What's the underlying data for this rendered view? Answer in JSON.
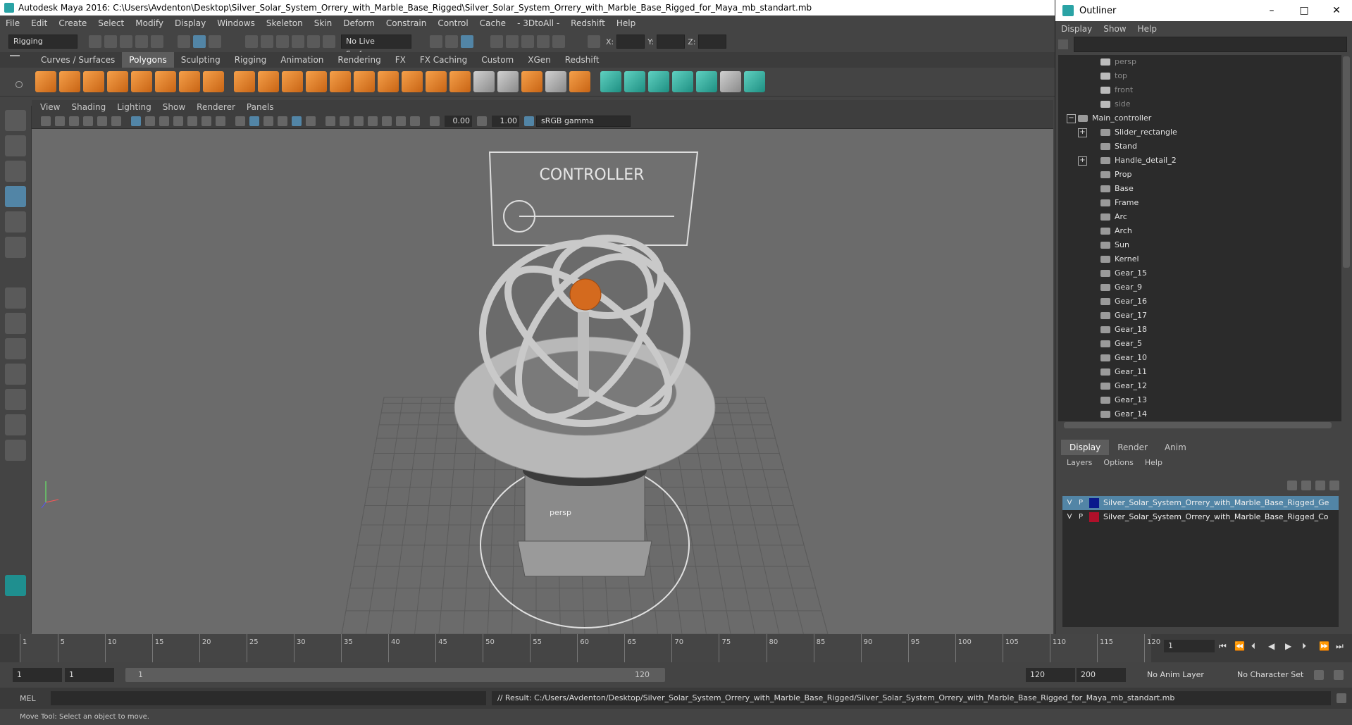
{
  "title": "Autodesk Maya 2016: C:\\Users\\Avdenton\\Desktop\\Silver_Solar_System_Orrery_with_Marble_Base_Rigged\\Silver_Solar_System_Orrery_with_Marble_Base_Rigged_for_Maya_mb_standart.mb",
  "menu": [
    "File",
    "Edit",
    "Create",
    "Select",
    "Modify",
    "Display",
    "Windows",
    "Skeleton",
    "Skin",
    "Deform",
    "Constrain",
    "Control",
    "Cache",
    "- 3DtoAll -",
    "Redshift",
    "Help"
  ],
  "statusline": {
    "mode": "Rigging",
    "live_surface": "No Live Surface",
    "x_label": "X:",
    "y_label": "Y:",
    "z_label": "Z:"
  },
  "shelf_tabs": [
    "Curves / Surfaces",
    "Polygons",
    "Sculpting",
    "Rigging",
    "Animation",
    "Rendering",
    "FX",
    "FX Caching",
    "Custom",
    "XGen",
    "Redshift"
  ],
  "shelf_active": "Polygons",
  "panel_menu": [
    "View",
    "Shading",
    "Lighting",
    "Show",
    "Renderer",
    "Panels"
  ],
  "panel_bar": {
    "exposure": "0.00",
    "gamma": "1.00",
    "colorspace": "sRGB gamma"
  },
  "viewport": {
    "camera_label": "persp",
    "controller_text": "CONTROLLER"
  },
  "outliner": {
    "title": "Outliner",
    "menu": [
      "Display",
      "Show",
      "Help"
    ],
    "items": [
      {
        "name": "persp",
        "type": "camera",
        "dim": true,
        "level": 2,
        "expand": ""
      },
      {
        "name": "top",
        "type": "camera",
        "dim": true,
        "level": 2,
        "expand": ""
      },
      {
        "name": "front",
        "type": "camera",
        "dim": true,
        "level": 2,
        "expand": ""
      },
      {
        "name": "side",
        "type": "camera",
        "dim": true,
        "level": 2,
        "expand": ""
      },
      {
        "name": "Main_controller",
        "type": "node",
        "dim": false,
        "level": 1,
        "expand": "−"
      },
      {
        "name": "Slider_rectangle",
        "type": "node",
        "dim": false,
        "level": 2,
        "expand": "+"
      },
      {
        "name": "Stand",
        "type": "node",
        "dim": false,
        "level": 2,
        "expand": ""
      },
      {
        "name": "Handle_detail_2",
        "type": "node",
        "dim": false,
        "level": 2,
        "expand": "+"
      },
      {
        "name": "Prop",
        "type": "node",
        "dim": false,
        "level": 2,
        "expand": ""
      },
      {
        "name": "Base",
        "type": "node",
        "dim": false,
        "level": 2,
        "expand": ""
      },
      {
        "name": "Frame",
        "type": "node",
        "dim": false,
        "level": 2,
        "expand": ""
      },
      {
        "name": "Arc",
        "type": "node",
        "dim": false,
        "level": 2,
        "expand": ""
      },
      {
        "name": "Arch",
        "type": "node",
        "dim": false,
        "level": 2,
        "expand": ""
      },
      {
        "name": "Sun",
        "type": "node",
        "dim": false,
        "level": 2,
        "expand": ""
      },
      {
        "name": "Kernel",
        "type": "node",
        "dim": false,
        "level": 2,
        "expand": ""
      },
      {
        "name": "Gear_15",
        "type": "node",
        "dim": false,
        "level": 2,
        "expand": ""
      },
      {
        "name": "Gear_9",
        "type": "node",
        "dim": false,
        "level": 2,
        "expand": ""
      },
      {
        "name": "Gear_16",
        "type": "node",
        "dim": false,
        "level": 2,
        "expand": ""
      },
      {
        "name": "Gear_17",
        "type": "node",
        "dim": false,
        "level": 2,
        "expand": ""
      },
      {
        "name": "Gear_18",
        "type": "node",
        "dim": false,
        "level": 2,
        "expand": ""
      },
      {
        "name": "Gear_5",
        "type": "node",
        "dim": false,
        "level": 2,
        "expand": ""
      },
      {
        "name": "Gear_10",
        "type": "node",
        "dim": false,
        "level": 2,
        "expand": ""
      },
      {
        "name": "Gear_11",
        "type": "node",
        "dim": false,
        "level": 2,
        "expand": ""
      },
      {
        "name": "Gear_12",
        "type": "node",
        "dim": false,
        "level": 2,
        "expand": ""
      },
      {
        "name": "Gear_13",
        "type": "node",
        "dim": false,
        "level": 2,
        "expand": ""
      },
      {
        "name": "Gear_14",
        "type": "node",
        "dim": false,
        "level": 2,
        "expand": ""
      }
    ]
  },
  "layer_tabs": [
    "Display",
    "Render",
    "Anim"
  ],
  "layer_menu": [
    "Layers",
    "Options",
    "Help"
  ],
  "layers": [
    {
      "v": "V",
      "p": "P",
      "name": "Silver_Solar_System_Orrery_with_Marble_Base_Rigged_Ge",
      "color": "#0a1a8c",
      "selected": true
    },
    {
      "v": "V",
      "p": "P",
      "name": "Silver_Solar_System_Orrery_with_Marble_Base_Rigged_Co",
      "color": "#b0102a",
      "selected": false
    }
  ],
  "timeline": {
    "start": 1,
    "end": 120,
    "ticks": [
      1,
      5,
      10,
      15,
      20,
      25,
      30,
      35,
      40,
      45,
      50,
      55,
      60,
      65,
      70,
      75,
      80,
      85,
      90,
      95,
      100,
      105,
      110,
      115,
      120
    ],
    "current": "1"
  },
  "range": {
    "start": "1",
    "anim_start": "1",
    "slider_start": "1",
    "slider_end": "120",
    "end": "120",
    "anim_end": "200",
    "anim_layer": "No Anim Layer",
    "char_set": "No Character Set"
  },
  "command": {
    "label": "MEL",
    "result": "// Result: C:/Users/Avdenton/Desktop/Silver_Solar_System_Orrery_with_Marble_Base_Rigged/Silver_Solar_System_Orrery_with_Marble_Base_Rigged_for_Maya_mb_standart.mb"
  },
  "help_line": "Move Tool: Select an object to move."
}
